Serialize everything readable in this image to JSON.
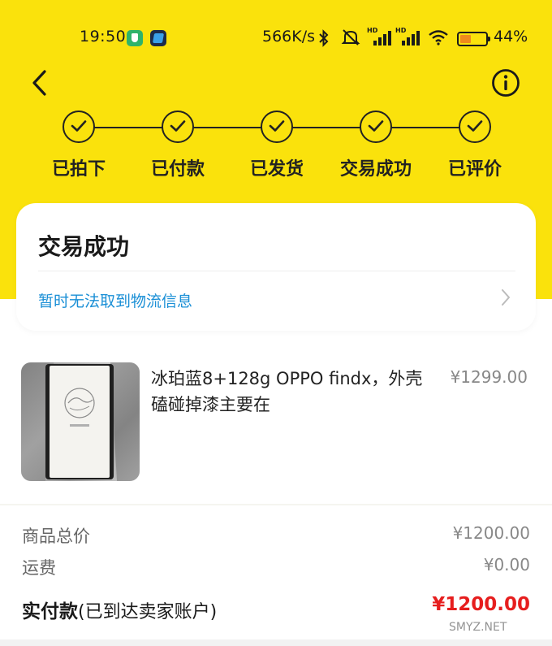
{
  "status_bar": {
    "time": "19:50",
    "net_speed": "566K/s",
    "signal_label_1": "HD",
    "signal_label_2": "HD",
    "battery_pct": "44%",
    "battery_level": 0.44,
    "battery_color": "#f08a1c"
  },
  "header": {
    "back_icon": "chevron-left-icon",
    "info_icon": "info-circle-icon"
  },
  "progress": {
    "steps": [
      {
        "label": "已拍下",
        "done": true
      },
      {
        "label": "已付款",
        "done": true
      },
      {
        "label": "已发货",
        "done": true
      },
      {
        "label": "交易成功",
        "done": true
      },
      {
        "label": "已评价",
        "done": true
      }
    ]
  },
  "status_card": {
    "title": "交易成功",
    "logistics": "暂时无法取到物流信息"
  },
  "product": {
    "title": "冰珀蓝8+128g OPPO findx，外壳磕碰掉漆主要在",
    "price": "¥1299.00"
  },
  "totals": {
    "goods_label": "商品总价",
    "goods_value": "¥1200.00",
    "shipping_label": "运费",
    "shipping_value": "¥0.00",
    "paid_label": "实付款",
    "paid_note": "(已到达卖家账户)",
    "paid_value": "¥1200.00"
  },
  "watermark": "SMYZ.NET",
  "colors": {
    "header_yellow": "#fae20c",
    "link_blue": "#1a8fd6",
    "price_red": "#e61e1e"
  }
}
